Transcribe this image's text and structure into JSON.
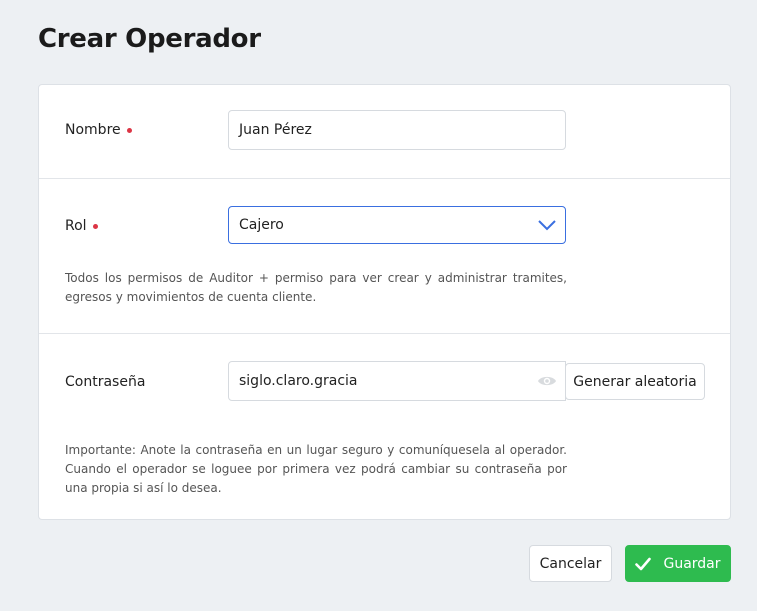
{
  "page": {
    "title": "Crear Operador"
  },
  "form": {
    "nombre": {
      "label": "Nombre",
      "value": "Juan Pérez",
      "required": true
    },
    "rol": {
      "label": "Rol",
      "value": "Cajero",
      "required": true,
      "help": "Todos los permisos de Auditor + permiso para ver crear y administrar tramites, egresos y movimientos de cuenta cliente."
    },
    "password": {
      "label": "Contraseña",
      "value": "siglo.claro.gracia",
      "generate_label": "Generar aleatoria",
      "help": "Importante: Anote la contraseña en un lugar seguro y comuníquesela al operador. Cuando el operador se loguee por primera vez podrá cambiar su contraseña por una propia si así lo desea."
    }
  },
  "actions": {
    "cancel_label": "Cancelar",
    "save_label": "Guardar"
  },
  "colors": {
    "required": "#dc3545",
    "primary": "#2ebb4f",
    "focus": "#3a6fe0"
  }
}
